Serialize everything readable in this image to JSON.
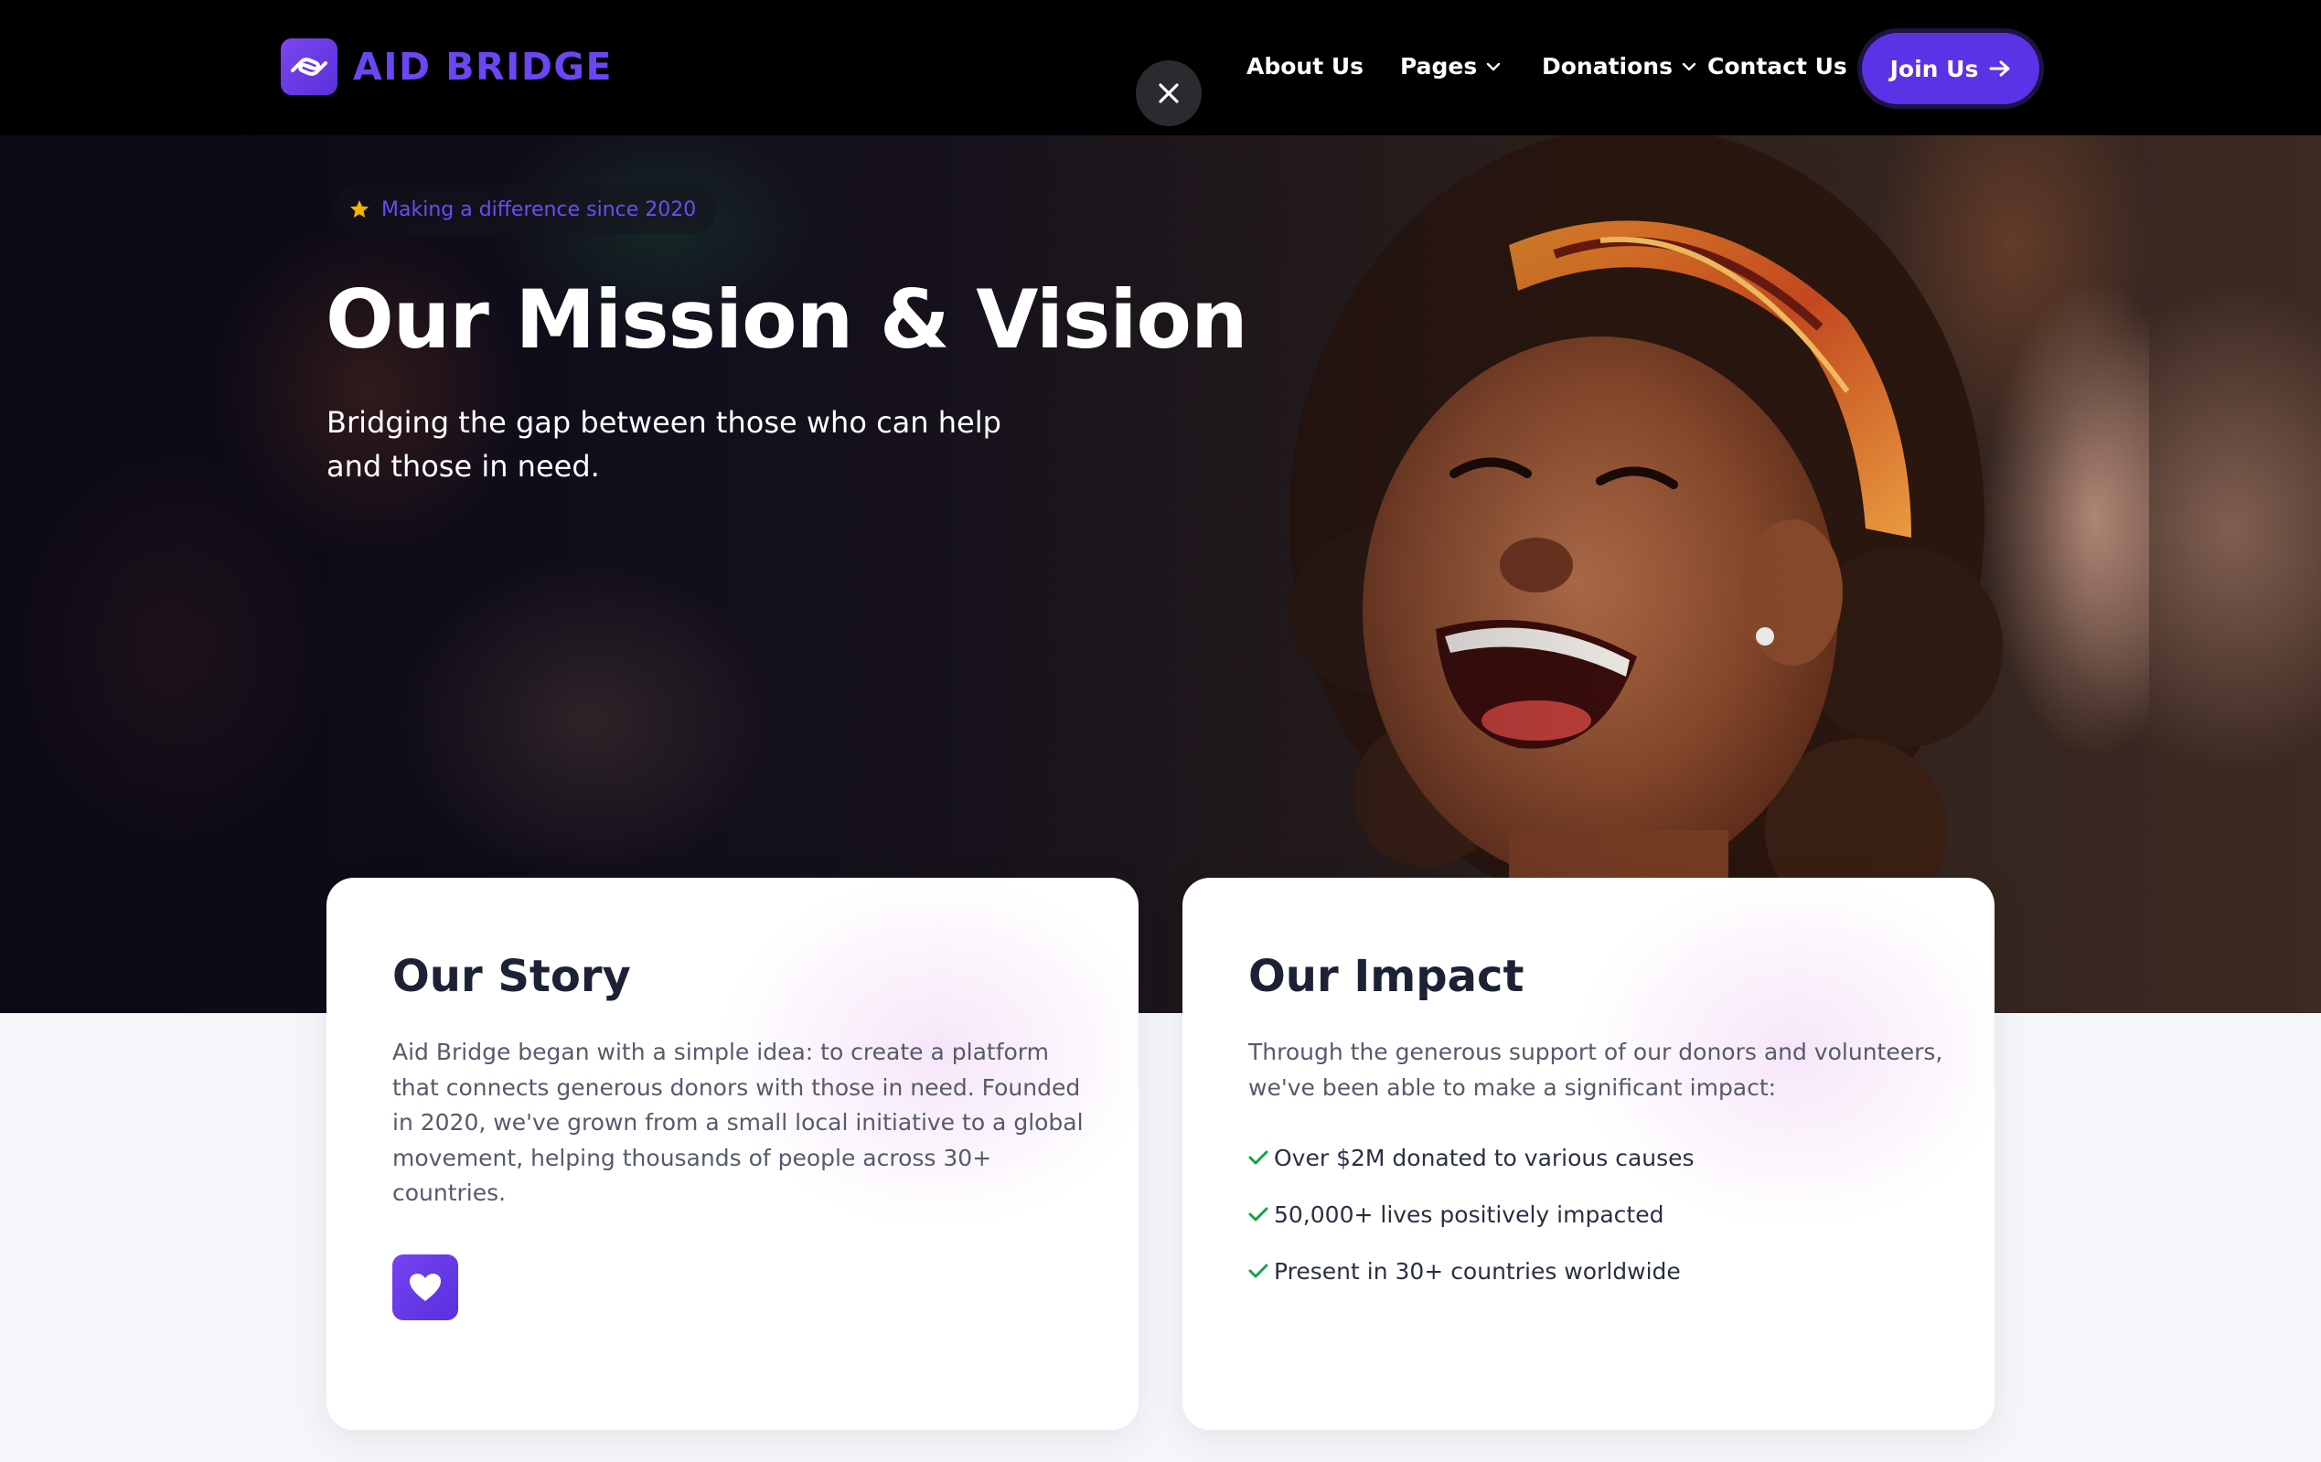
{
  "nav": {
    "brand": "AID BRIDGE",
    "links": [
      {
        "label": "About Us"
      },
      {
        "label": "Pages"
      },
      {
        "label": "Donations"
      },
      {
        "label": "Contact Us"
      }
    ],
    "join_label": "Join Us"
  },
  "hero": {
    "badge": "Making a difference since 2020",
    "title": "Our Mission & Vision",
    "subtitle_line1": "Bridging the gap between those who can help",
    "subtitle_line2": "and those in need."
  },
  "story": {
    "title": "Our Story",
    "body": "Aid Bridge began with a simple idea: to create a platform that connects generous donors with those in need. Founded in 2020, we've grown from a small local initiative to a global movement, helping thousands of people across 30+ countries."
  },
  "impact": {
    "title": "Our Impact",
    "intro": "Through the generous support of our donors and volunteers, we've been able to make a significant impact:",
    "items": [
      "Over $2M donated to various causes",
      "50,000+ lives positively impacted",
      "Present in 30+ countries worldwide"
    ]
  },
  "colors": {
    "brand": "#6b46f3",
    "button": "#5b32e6",
    "check": "#16a34a",
    "star": "#f5b300"
  },
  "icons": [
    "hands-logo-icon",
    "close-icon",
    "chevron-down-icon",
    "arrow-right-icon",
    "star-icon",
    "heart-icon",
    "check-icon"
  ]
}
